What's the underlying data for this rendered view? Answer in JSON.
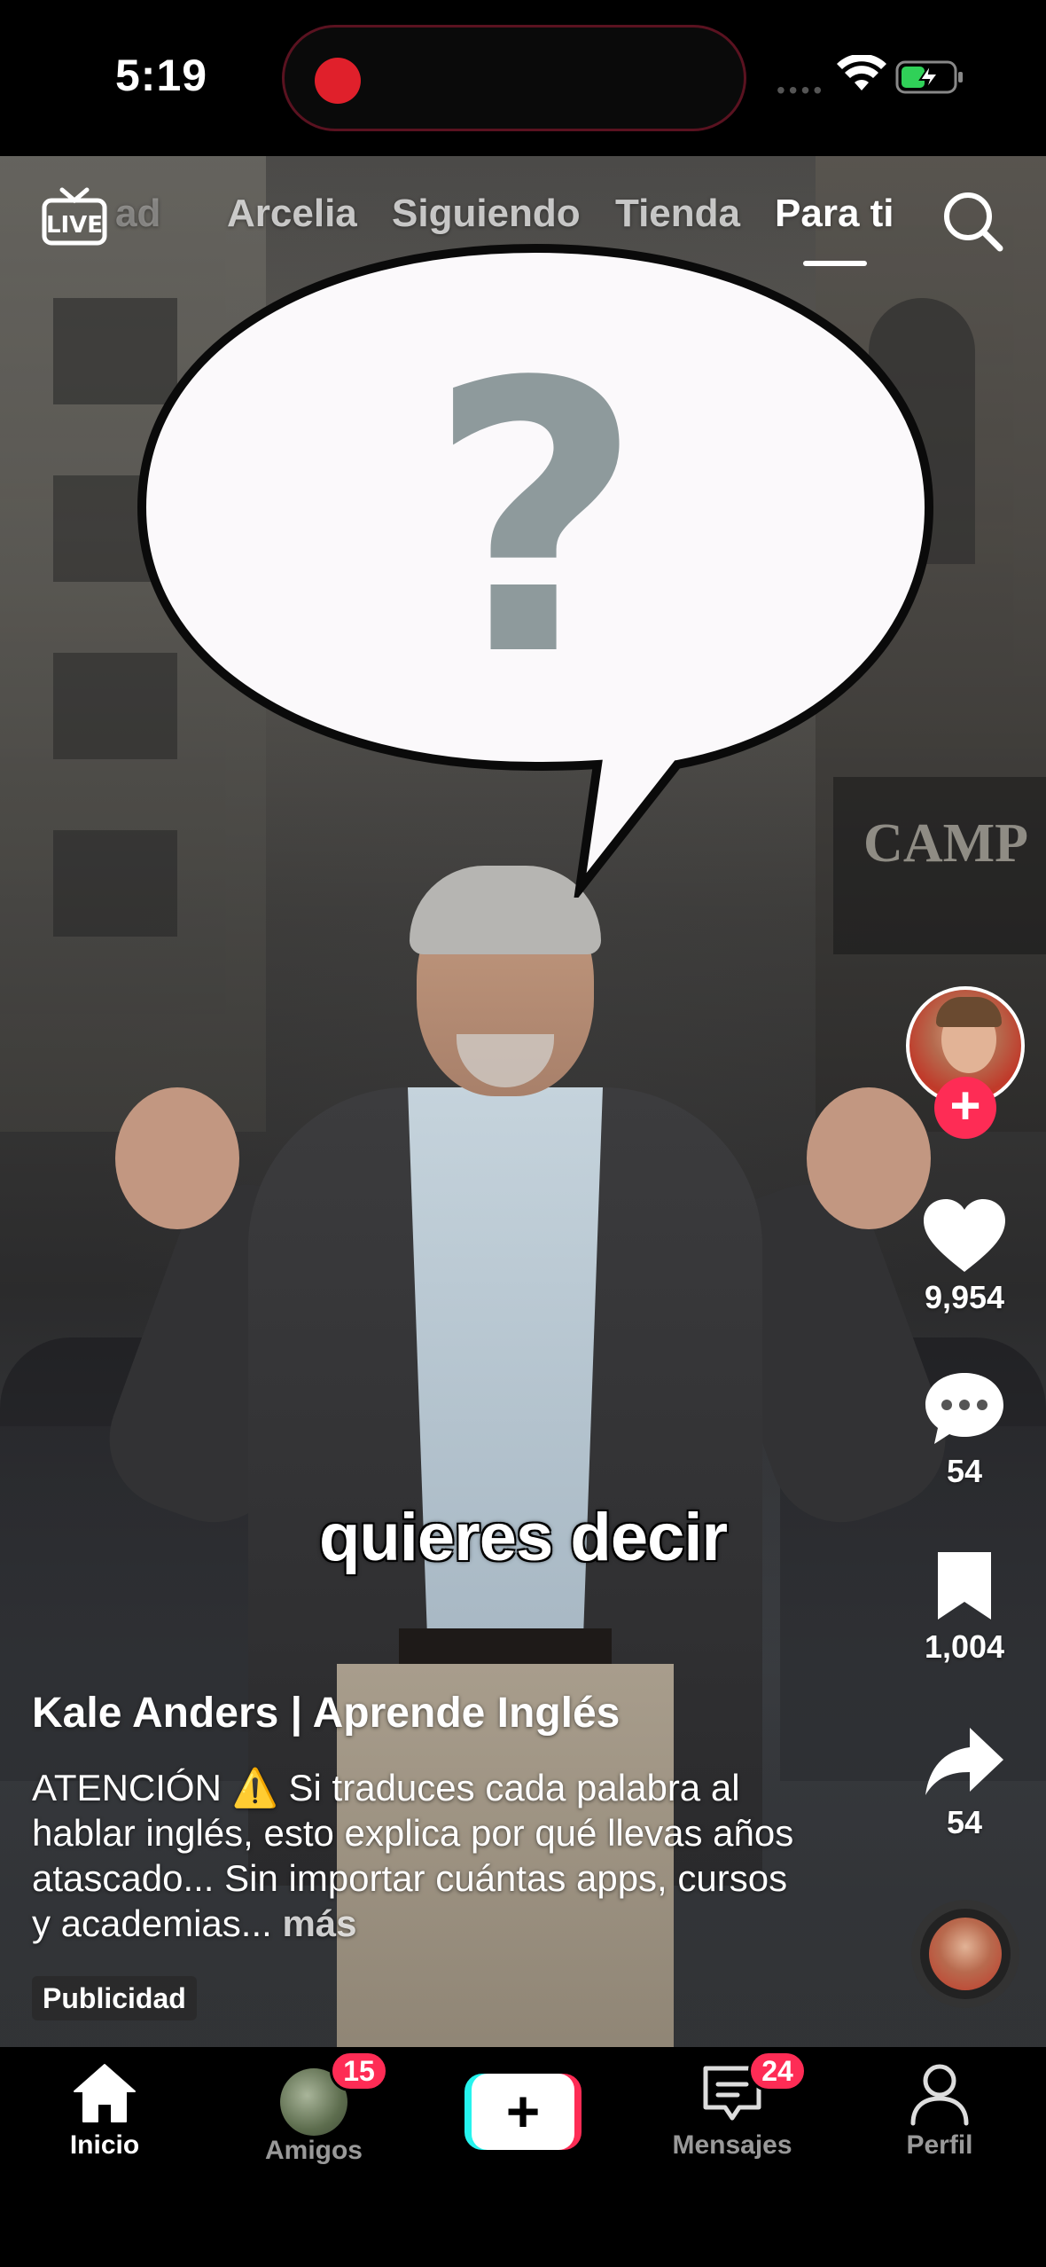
{
  "status_bar": {
    "time": "5:19"
  },
  "top_nav": {
    "live_label": "LIVE",
    "tabs": [
      {
        "label": "ad",
        "state": "faded"
      },
      {
        "label": "Arcelia",
        "state": "inactive"
      },
      {
        "label": "Siguiendo",
        "state": "inactive"
      },
      {
        "label": "Tienda",
        "state": "inactive"
      },
      {
        "label": "Para ti",
        "state": "active"
      }
    ],
    "search_icon": "search-icon"
  },
  "video": {
    "bubble_symbol": "?",
    "caption": "quieres decir",
    "background_sign": "CAMP"
  },
  "actions": {
    "likes": "9,954",
    "comments": "54",
    "saves": "1,004",
    "shares": "54"
  },
  "post": {
    "username": "Kale Anders | Aprende Inglés",
    "description_prefix": "ATENCIÓN",
    "description_emoji": "⚠️",
    "description_text": " Si traduces cada palabra al hablar inglés, esto explica por qué llevas años atascado... Sin importar cuántas apps, cursos y academias...",
    "more_label": " más",
    "ad_label": "Publicidad"
  },
  "tab_bar": {
    "home_label": "Inicio",
    "friends_label": "Amigos",
    "friends_badge": "15",
    "inbox_label": "Mensajes",
    "inbox_badge": "24",
    "profile_label": "Perfil"
  },
  "colors": {
    "accent_pink": "#fe2c55",
    "accent_cyan": "#25f4ee",
    "recording_red": "#e0202b"
  }
}
